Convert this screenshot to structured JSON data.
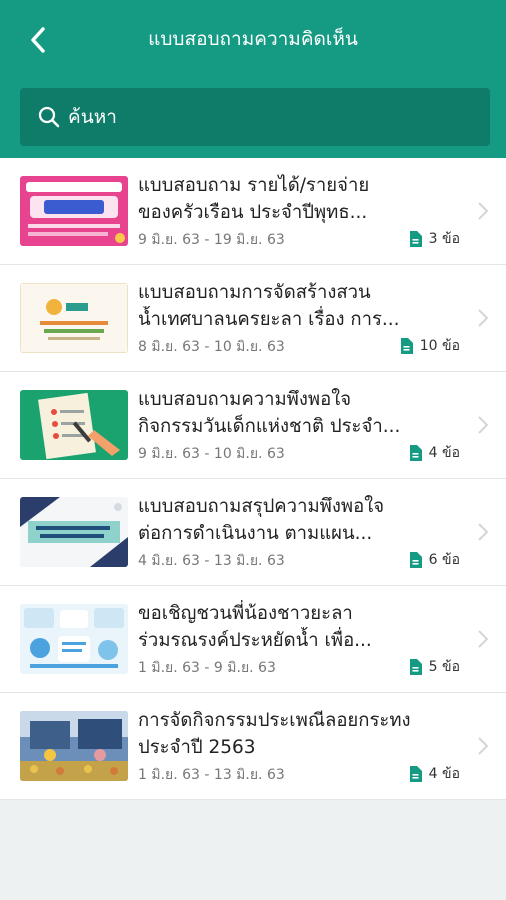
{
  "header": {
    "title": "แบบสอบถามความคิดเห็น"
  },
  "search": {
    "label": "ค้นหา"
  },
  "colors": {
    "primary": "#159b84",
    "search_bg": "#0e7c69",
    "accent_icon": "#159b84"
  },
  "items": [
    {
      "title_line1": "แบบสอบถาม รายได้/รายจ่าย",
      "title_line2": "ของครัวเรือน ประจำปีพุทธ...",
      "date": "9 มิ.ย. 63 - 19 มิ.ย. 63",
      "count": "3 ข้อ"
    },
    {
      "title_line1": "แบบสอบถามการจัดสร้างสวน",
      "title_line2": "น้ำเทศบาลนครยะลา เรื่อง การ...",
      "date": "8 มิ.ย. 63 - 10 มิ.ย. 63",
      "count": "10 ข้อ"
    },
    {
      "title_line1": "แบบสอบถามความพึงพอใจ",
      "title_line2": "กิจกรรมวันเด็กแห่งชาติ ประจำ...",
      "date": "9 มิ.ย. 63 - 10 มิ.ย. 63",
      "count": "4 ข้อ"
    },
    {
      "title_line1": "แบบสอบถามสรุปความพึงพอใจ",
      "title_line2": "ต่อการดำเนินงาน ตามแผน...",
      "date": "4 มิ.ย. 63 - 13 มิ.ย. 63",
      "count": "6 ข้อ"
    },
    {
      "title_line1": "ขอเชิญชวนพี่น้องชาวยะลา",
      "title_line2": "ร่วมรณรงค์ประหยัดน้ำ เพื่อ...",
      "date": "1 มิ.ย. 63 - 9 มิ.ย. 63",
      "count": "5 ข้อ"
    },
    {
      "title_line1": "การจัดกิจกรรมประเพณีลอยกระทง",
      "title_line2": "ประจำปี 2563",
      "date": "1 มิ.ย. 63 - 13 มิ.ย. 63",
      "count": "4 ข้อ"
    }
  ]
}
